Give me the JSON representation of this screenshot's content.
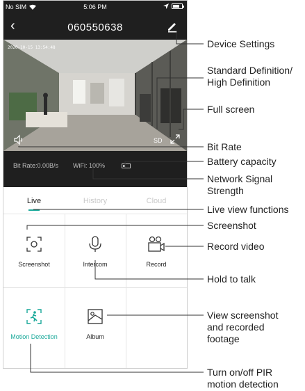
{
  "status_bar": {
    "carrier": "No SIM",
    "time": "5:06 PM",
    "battery_level": 0.75
  },
  "navbar": {
    "back_icon": "chevron-left-icon",
    "title": "060550638",
    "edit_icon": "pencil-icon"
  },
  "video": {
    "timestamp": "2020-10-15 13:54:48",
    "quality": "SD",
    "speaker_icon": "speaker-icon",
    "fullscreen_icon": "expand-icon"
  },
  "info_bar": {
    "bit_rate": "Bit Rate:0.00B/s",
    "wifi": "WiFi: 100%",
    "battery_icon": "battery-icon"
  },
  "tabs": [
    {
      "label": "Live"
    },
    {
      "label": "History"
    },
    {
      "label": "Cloud"
    }
  ],
  "functions": {
    "screenshot": "Screenshot",
    "intercom": "Intercom",
    "record": "Record",
    "motion_detection": "Motion Detection",
    "album": "Album"
  },
  "annotations": {
    "device_settings": "Device Settings",
    "definition_1": "Standard Definition/",
    "definition_2": "High Definition",
    "full_screen": "Full screen",
    "bit_rate": "Bit Rate",
    "battery_capacity": "Battery capacity",
    "network_1": "Network Signal",
    "network_2": "Strength",
    "live_view": "Live view functions",
    "screenshot": "Screenshot",
    "record_video": "Record video",
    "hold_to_talk": "Hold to talk",
    "view_1": "View screenshot",
    "view_2": "and recorded",
    "view_3": "footage",
    "pir_1": "Turn on/off PIR",
    "pir_2": "motion detection"
  },
  "colors": {
    "accent": "#1aa99a",
    "dark_bg": "#1f1f1f"
  }
}
